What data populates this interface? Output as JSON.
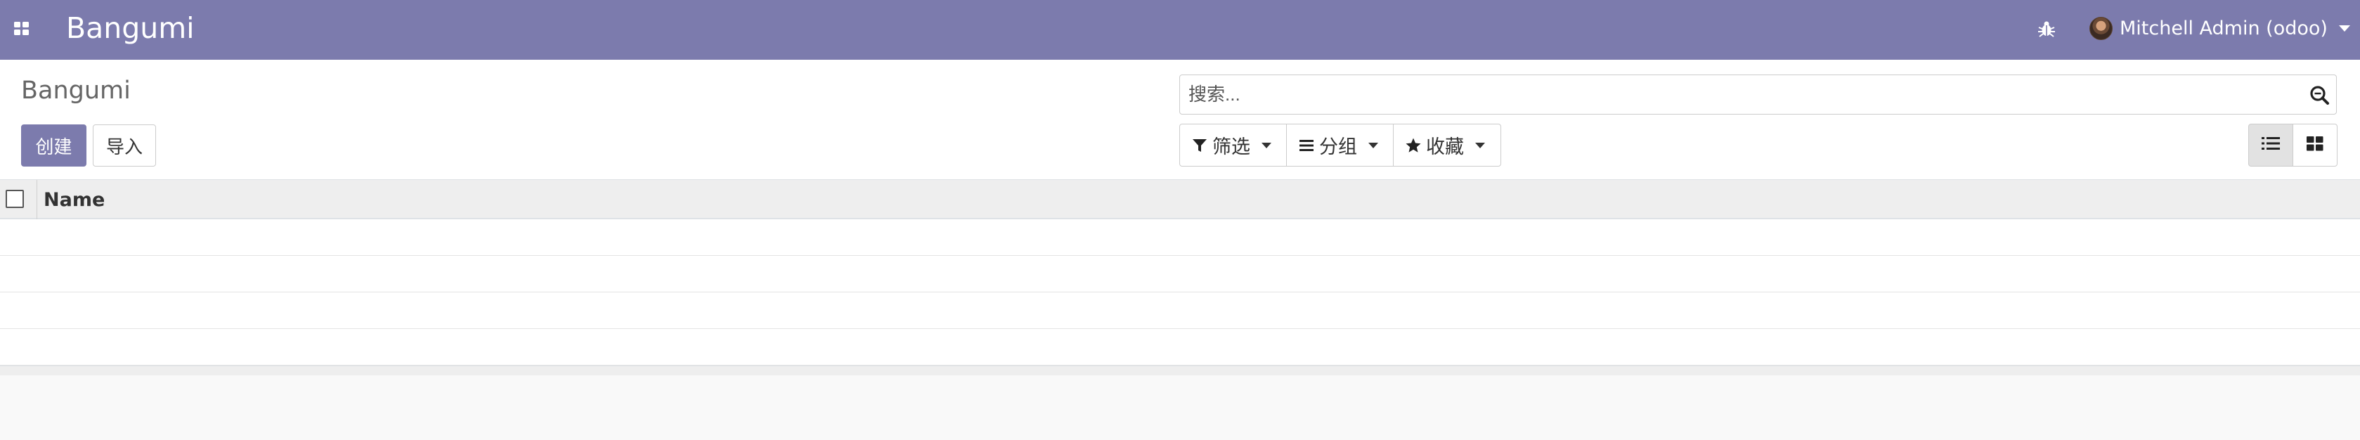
{
  "navbar": {
    "brand": "Bangumi",
    "user_name": "Mitchell Admin (odoo)",
    "icons": {
      "apps": "apps-grid-icon",
      "debug": "bug-icon",
      "user_caret": "caret-down-icon"
    },
    "colors": {
      "bar": "#7c7bad",
      "text": "#ffffff"
    }
  },
  "control_panel": {
    "breadcrumb": "Bangumi",
    "create_label": "创建",
    "import_label": "导入",
    "search": {
      "placeholder": "搜索...",
      "value": ""
    },
    "filters_label": "筛选",
    "group_label": "分组",
    "favorites_label": "收藏",
    "views": [
      {
        "name": "list",
        "icon": "list-icon",
        "active": true
      },
      {
        "name": "kanban",
        "icon": "kanban-icon",
        "active": false
      }
    ]
  },
  "list": {
    "columns": [
      "Name"
    ],
    "rows": [
      "",
      "",
      "",
      ""
    ]
  }
}
